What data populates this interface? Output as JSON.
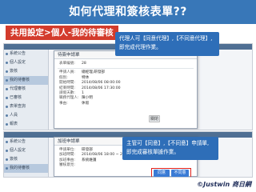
{
  "header": {
    "title": "如何代理和簽核表單??"
  },
  "breadcrumb": {
    "text": "共用設定>個人-我的待審核"
  },
  "sidebar": {
    "items": [
      {
        "label": "系統公告"
      },
      {
        "label": "個人設定"
      },
      {
        "label": "簽核"
      },
      {
        "label": "我的待審核"
      },
      {
        "label": "代理審核"
      },
      {
        "label": "已審核"
      },
      {
        "label": "表單查詢"
      },
      {
        "label": "人員"
      },
      {
        "label": "報表"
      }
    ]
  },
  "dialog1": {
    "title": "待簽申請單",
    "fields": [
      {
        "k": "表單編號:",
        "v": "28"
      },
      {
        "k": "申請人員:",
        "v": "總經理,研發部"
      },
      {
        "k": "假別:",
        "v": "特休"
      },
      {
        "k": "開始時間:",
        "v": "2014/08/06 08:00:00"
      },
      {
        "k": "結束時間:",
        "v": "2014/08/06 17:30:00"
      },
      {
        "k": "請假天數:",
        "v": "1"
      },
      {
        "k": "職務代理人:",
        "v": "陳小明"
      },
      {
        "k": "事由:",
        "v": "休假"
      }
    ],
    "close_label": "關閉"
  },
  "dialog2": {
    "title": "加班申請單",
    "fields": [
      {
        "k": "申請單位:",
        "v": "研發部"
      },
      {
        "k": "加班時間:",
        "v": "2014/08/06 18:00 ~ 21:00"
      },
      {
        "k": "加班事由:",
        "v": "系統維護"
      },
      {
        "k": "審核意見:",
        "v": ""
      }
    ],
    "approve_label": "同意",
    "reject_label": "不同意"
  },
  "callouts": {
    "c1_line1": "代理人可【同意代理】,【不同意代理】,",
    "c1_line2": "即完成代理作業。",
    "c2_line1": "主管可【同意】,【不同意】申請單,",
    "c2_line2": "即完成審核單據作業。"
  },
  "credit": "©Justwin 商日網"
}
